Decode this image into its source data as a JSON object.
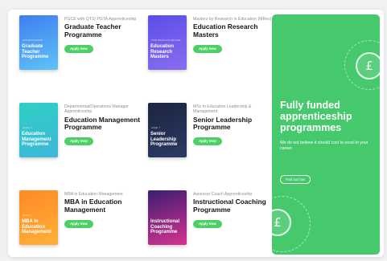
{
  "courses": [
    {
      "subtitle": "PGCE with QTS/ PGTA Apprenticeship",
      "title": "Graduate Teacher Programme",
      "cover_tag": "Apprenticeship",
      "cover_title": "Graduate Teacher Programme",
      "apply_label": "Apply Now",
      "cover_color_a": "#3f7ef0",
      "cover_color_b": "#5fc3f6"
    },
    {
      "subtitle": "Masters by Research in Education (MRes)",
      "title": "Education Research Masters",
      "cover_tag": "Postgraduate Degree",
      "cover_title": "Education Research Masters",
      "apply_label": "Apply Now",
      "cover_color_a": "#5b4ee8",
      "cover_color_b": "#8a6df0"
    },
    {
      "subtitle": "Departmental/Operations Manager Apprenticeship",
      "title": "Education Management Programme",
      "cover_tag": "Level 5",
      "cover_title": "Education Management Programme",
      "apply_label": "Apply Now",
      "cover_color_a": "#2ed0c4",
      "cover_color_b": "#3fb6d9"
    },
    {
      "subtitle": "MSc in Education Leadership & Management",
      "title": "Senior Leadership Programme",
      "cover_tag": "Level 7",
      "cover_title": "Senior Leadership Programme",
      "apply_label": "Apply Now",
      "cover_color_a": "#1c2540",
      "cover_color_b": "#2c3a63"
    },
    {
      "subtitle": "MBA in Education Management",
      "title": "MBA in Education Management",
      "cover_tag": "Level 7",
      "cover_title": "MBA in Education Management",
      "apply_label": "Apply Now",
      "cover_color_a": "#ff8a24",
      "cover_color_b": "#ffb03a"
    },
    {
      "subtitle": "Assessor Coach Apprenticeship",
      "title": "Instructional Coaching Programme",
      "cover_tag": "",
      "cover_title": "Instructional Coaching Programme",
      "apply_label": "Apply Now",
      "cover_color_a": "#3b1e73",
      "cover_color_b": "#d6338f"
    }
  ],
  "promo": {
    "title": "Fully funded apprenticeship programmes",
    "text": "We do not believe it should cost to excel in your career.",
    "button_label": "Find out how",
    "icon": "pound-coin-icon",
    "coin_symbol": "£",
    "color": "#45c96c"
  },
  "colors": {
    "apply_button": "#4cd064"
  }
}
